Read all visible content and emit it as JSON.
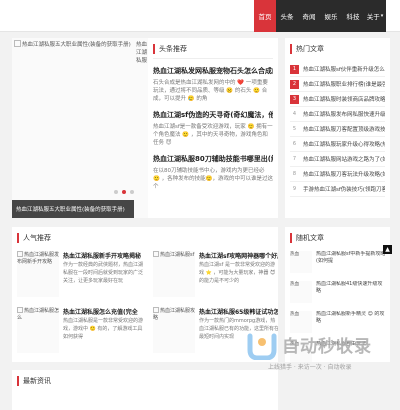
{
  "nav": {
    "items": [
      "首页",
      "头条",
      "奇闻",
      "娱乐",
      "科技",
      "关于"
    ],
    "dropdown_arrow": "▾"
  },
  "slider": {
    "alt": "热血江湖私服五大职业属性(装备的获取手册)",
    "caption": "热血江湖私服五大职业属性(装备的获取手册)",
    "alt2": "热血江湖私服",
    "dots": 3,
    "active_dot": 2
  },
  "headlines": {
    "title": "头条推荐",
    "items": [
      {
        "title": "热血江湖私发网私服宠物石头怎么合成的(热血江湖",
        "desc": "石头合成是热血江湖私发网的中的 ❤️ 一项重要玩法，通过将不同品质、等级 ☹️ 的石头 🙂 合成，可以提升 🥲 的角"
      },
      {
        "title": "热血江湖sf伪造的天寻奇(奇幻魔法，他到底是",
        "desc": "热血江湖sf是一款备受欢迎游戏，玩家 🙂 拥有一个角色魔法 🙂 ，其中的天寻奇物，游戏角色和任务 😈"
      },
      {
        "title": "热血江湖私服80刀辅助技能书哪里出(解密游",
        "desc": "在以80刀辅助技能书中心，游戏内为更已经必 🙂 ，各种发布的技能🙂，游戏的中可以谁是过这个"
      }
    ]
  },
  "hot": {
    "title": "热门文章",
    "items": [
      "热血江湖私服sf伙伴重新升级怎么(热",
      "热血江湖私服职业排行榜(谁是最强的",
      "热血江湖私服时装领商店品牌攻略(如",
      "热血江湖私服发布网私服快速升级方法是",
      "热血江湖私服刀客配置顶级游戏技能升",
      "热血江湖私服玩家升级心得攻略(热血",
      "热血江湖私服网站游戏之路为了(如何",
      "热血江湖私服刀客玩法升级攻略(如何",
      "手游热血江湖sf伪装技巧(领跑刀客手"
    ]
  },
  "popular": {
    "title": "人气推荐",
    "items": [
      {
        "thumb": "热血江湖私服发布网新手开攻略",
        "title": "热血江湖私服新手开攻略揭秘",
        "desc": "作为一款经典的武侠题材，热血江湖私服在一段时间后就受到玩家的广泛关注，让更多玩家最好在玩"
      },
      {
        "thumb": "热血江湖私服sf",
        "title": "热血江湖sf攻略网神器哪个好用啊",
        "desc": "热血江湖sf 是一款非常受欢迎的游戏 ⭐ ，可能为大量玩家，神器 😈 的能力是不可少的"
      },
      {
        "thumb": "热血江湖私服怎么",
        "title": "热血江湖私服怎么充值(完全",
        "desc": "热血江湖私服是一款非常受欢迎的游戏，游戏中 🙂 有的，了解游戏工具如何获得"
      },
      {
        "thumb": "热血江湖私服攻略",
        "title": "热血江湖私服65级韩证试功怎么",
        "desc": "作为一款热门的mmorpg游戏，热血江湖私服已有的功能，这里所有在最短时间内实现"
      }
    ]
  },
  "random": {
    "title": "随机文章",
    "items": [
      {
        "thumb": "热血",
        "text": "热血江湖私服sf中新手提新攻略(如何提"
      },
      {
        "thumb": "热血",
        "text": "热血江湖私服41级快速升级攻略"
      },
      {
        "thumb": "热血",
        "text": "热血江湖私服新手精灵 😊 的攻略"
      },
      {
        "thumb": "热血",
        "text": "热血江湖私服自由玩法"
      }
    ]
  },
  "latest": {
    "title": "最新资讯"
  },
  "totop": "▲",
  "watermark": {
    "text": "自动秒收录",
    "sub": "上线猎手 · 来访一次 · 自动收录"
  },
  "colors": {
    "accent": "#d9343a",
    "nav_bg": "#2b2b2b"
  }
}
